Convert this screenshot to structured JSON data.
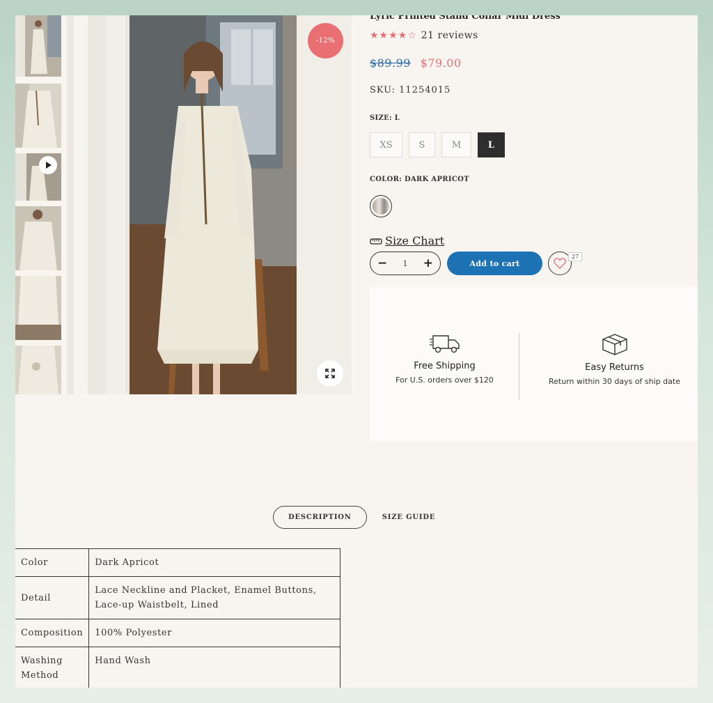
{
  "product": {
    "title": "Lyric Printed Stand Collar Midi Dress",
    "rating_stars": "★★★★☆",
    "reviews": "21 reviews",
    "old_price": "$89.99",
    "new_price": "$79.00",
    "sku": "SKU: 11254015",
    "discount_badge": "-12%"
  },
  "size": {
    "label": "SIZE: L",
    "options": [
      "XS",
      "S",
      "M",
      "L"
    ],
    "selected": "L"
  },
  "color": {
    "label": "COLOR: DARK APRICOT"
  },
  "size_chart_label": "Size Chart",
  "quantity": {
    "minus": "−",
    "value": "1",
    "plus": "+"
  },
  "add_to_cart_label": "Add to cart",
  "wishlist_count": "27",
  "perks": [
    {
      "title": "Free Shipping",
      "subtitle": "For U.S. orders over $120"
    },
    {
      "title": "Easy Returns",
      "subtitle": "Return within 30 days of ship date"
    }
  ],
  "tabs": [
    {
      "label": "DESCRIPTION"
    },
    {
      "label": "SIZE GUIDE"
    }
  ],
  "spec_table": [
    {
      "key": "Color",
      "value": "Dark Apricot"
    },
    {
      "key": "Detail",
      "value": "Lace Neckline and Placket, Enamel Buttons, Lace-up Waistbelt, Lined"
    },
    {
      "key": "Composition",
      "value": "100% Polyester"
    },
    {
      "key": "Washing Method",
      "value": "Hand Wash"
    }
  ],
  "colors": {
    "accent_blue": "#1d72b3",
    "sale_red": "#e86d72",
    "selected_dark": "#2e2e2e"
  }
}
